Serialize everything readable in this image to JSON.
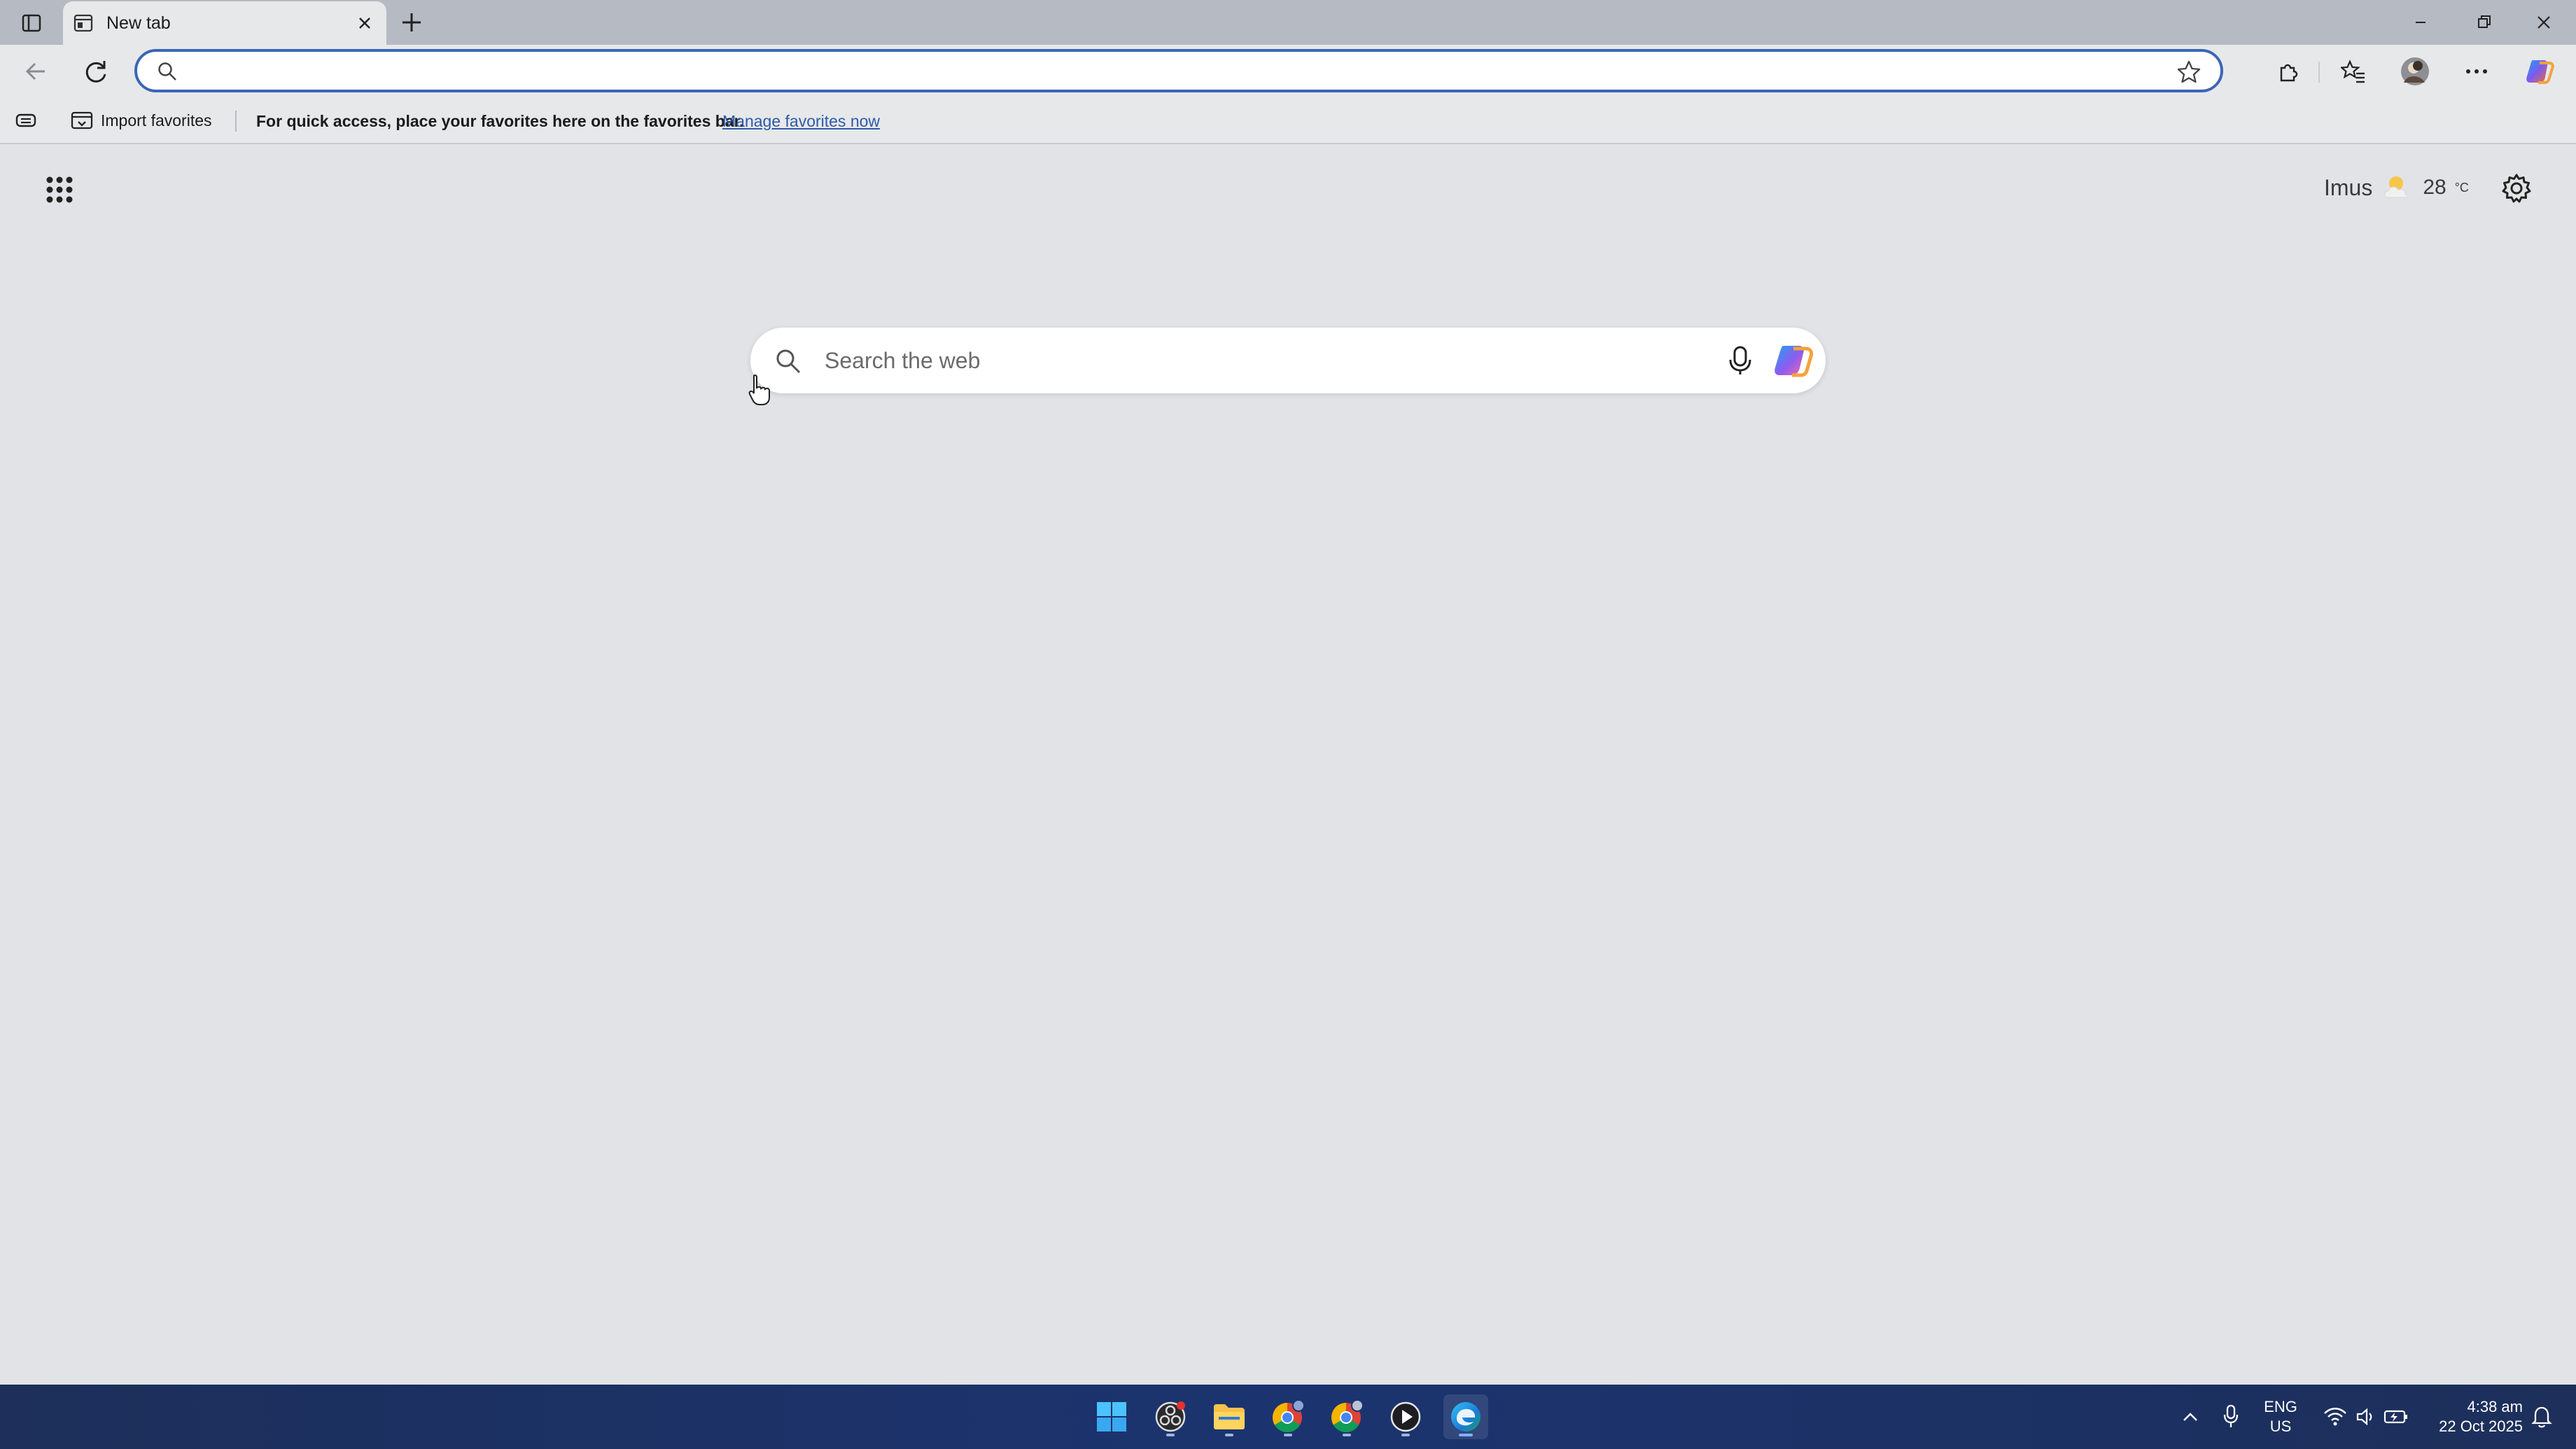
{
  "browser": {
    "tab": {
      "title": "New tab"
    },
    "address_bar": {
      "value": "",
      "placeholder": ""
    },
    "favorites_bar": {
      "import_label": "Import favorites",
      "message": "For quick access, place your favorites here on the favorites bar.",
      "link": "Manage favorites now"
    }
  },
  "new_tab_page": {
    "weather": {
      "location": "Imus",
      "temperature": "28",
      "unit": "°C"
    },
    "search": {
      "placeholder": "Search the web",
      "value": ""
    }
  },
  "taskbar": {
    "apps": [
      "windows-start",
      "obs-studio",
      "file-explorer",
      "chrome",
      "chrome-profile",
      "media-player",
      "edge"
    ],
    "language": {
      "line1": "ENG",
      "line2": "US"
    },
    "clock": {
      "time": "4:38 am",
      "date": "22 Oct 2025"
    }
  },
  "colors": {
    "accent": "#3b66b7",
    "taskbar": "#1b3470",
    "page_bg": "#e2e3e6"
  }
}
